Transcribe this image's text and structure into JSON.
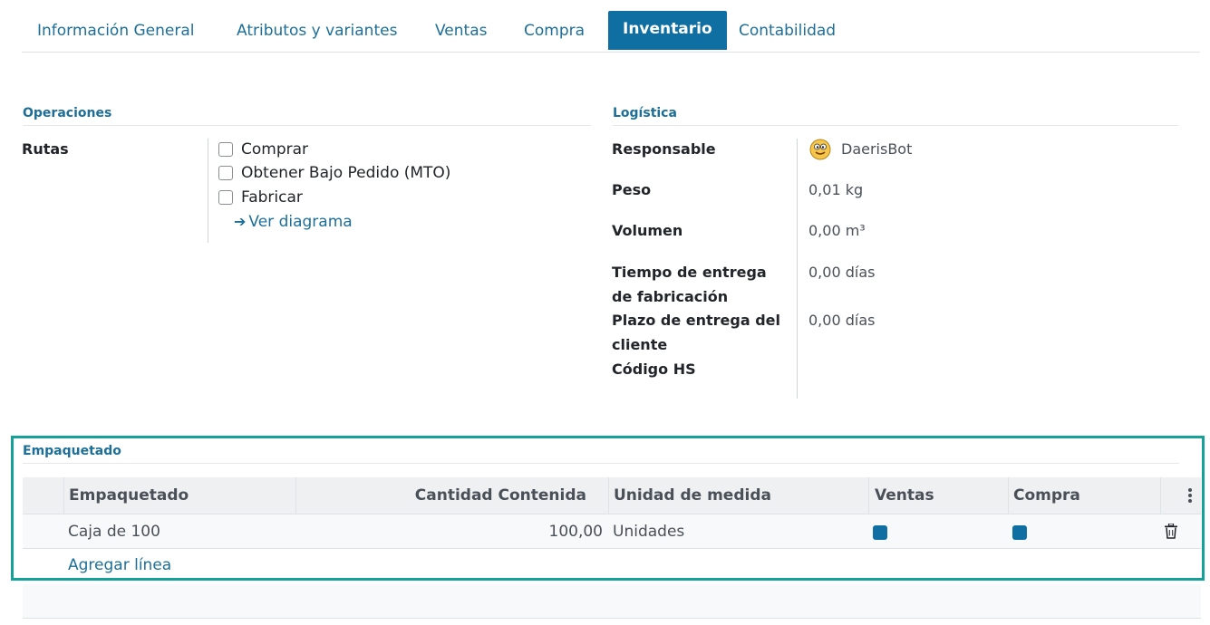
{
  "tabs": [
    {
      "label": "Información General",
      "active": false
    },
    {
      "label": "Atributos y variantes",
      "active": false
    },
    {
      "label": "Ventas",
      "active": false
    },
    {
      "label": "Compra",
      "active": false
    },
    {
      "label": "Inventario",
      "active": true
    },
    {
      "label": "Contabilidad",
      "active": false
    }
  ],
  "operations": {
    "title": "Operaciones",
    "routes_label": "Rutas",
    "routes": [
      {
        "label": "Comprar",
        "checked": false
      },
      {
        "label": "Obtener Bajo Pedido (MTO)",
        "checked": false
      },
      {
        "label": "Fabricar",
        "checked": false
      }
    ],
    "diagram_link": "Ver diagrama"
  },
  "logistics": {
    "title": "Logística",
    "responsible_label": "Responsable",
    "responsible_value": "DaerisBot",
    "weight_label": "Peso",
    "weight_value": "0,01",
    "weight_unit": "kg",
    "volume_label": "Volumen",
    "volume_value": "0,00",
    "volume_unit": "m³",
    "manufacturing_lead_label_1": "Tiempo de entrega",
    "manufacturing_lead_label_2": "de fabricación",
    "manufacturing_lead_value": "0,00 días",
    "customer_lead_label_1": "Plazo de entrega del",
    "customer_lead_label_2": "cliente",
    "customer_lead_value": "0,00 días",
    "hs_code_label": "Código HS"
  },
  "packaging": {
    "title": "Empaquetado",
    "columns": [
      "Empaquetado",
      "Cantidad Contenida",
      "Unidad de medida",
      "Ventas",
      "Compra"
    ],
    "rows": [
      {
        "name": "Caja de 100",
        "qty": "100,00",
        "uom": "Unidades",
        "sales": true,
        "purchase": true
      }
    ],
    "add_line": "Agregar línea"
  },
  "colors": {
    "accent": "#0f6fa3",
    "link": "#1d6f98",
    "highlight": "#14a19a"
  }
}
